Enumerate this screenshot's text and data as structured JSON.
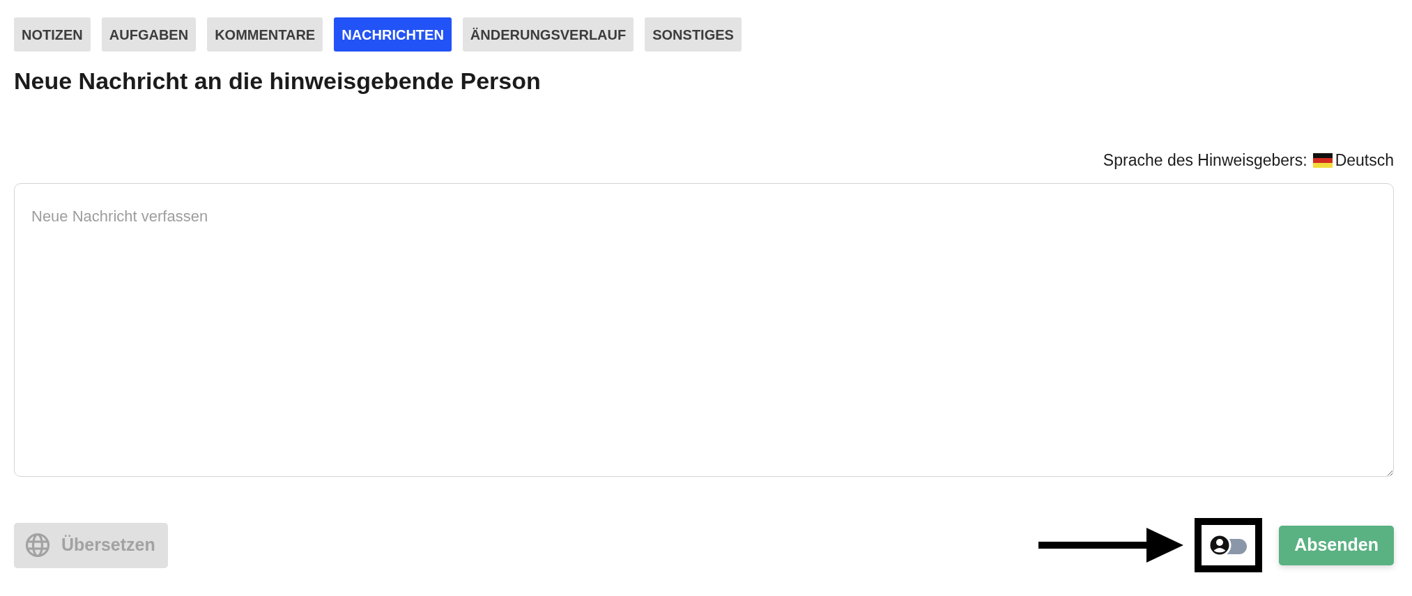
{
  "tabs": [
    {
      "label": "NOTIZEN",
      "selected": false
    },
    {
      "label": "AUFGABEN",
      "selected": false
    },
    {
      "label": "KOMMENTARE",
      "selected": false
    },
    {
      "label": "NACHRICHTEN",
      "selected": true
    },
    {
      "label": "ÄNDERUNGSVERLAUF",
      "selected": false
    },
    {
      "label": "SONSTIGES",
      "selected": false
    }
  ],
  "heading": "Neue Nachricht an die hinweisgebende Person",
  "language": {
    "label": "Sprache des Hinweisgebers:",
    "value": "Deutsch"
  },
  "message": {
    "placeholder": "Neue Nachricht verfassen"
  },
  "translate_button": {
    "label": "Übersetzen",
    "disabled": true
  },
  "identity_toggle": {
    "on": false
  },
  "send_button": {
    "label": "Absenden"
  }
}
